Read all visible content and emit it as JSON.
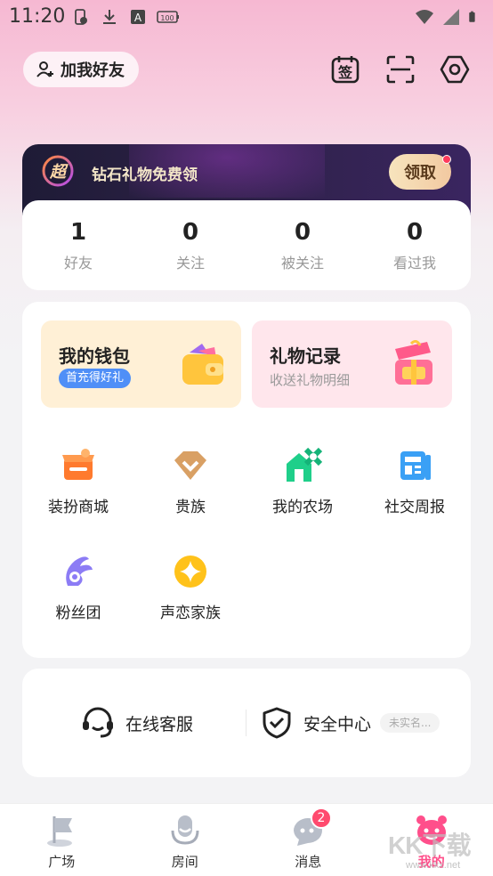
{
  "status_bar": {
    "time": "11:20",
    "left_icons": [
      "battery-saver-icon",
      "download-icon",
      "a-icon",
      "battery-100-icon"
    ],
    "battery_label": "100",
    "right_icons": [
      "wifi-icon",
      "signal-icon",
      "battery-icon"
    ]
  },
  "header": {
    "add_friend_label": "加我好友",
    "sign_in_label": "签",
    "icons": [
      "calendar-sign-icon",
      "scan-icon",
      "settings-icon"
    ]
  },
  "vip_banner": {
    "badge_text": "超",
    "text": "钻石礼物免费领",
    "claim_label": "领取"
  },
  "stats": [
    {
      "value": "1",
      "label": "好友"
    },
    {
      "value": "0",
      "label": "关注"
    },
    {
      "value": "0",
      "label": "被关注"
    },
    {
      "value": "0",
      "label": "看过我"
    }
  ],
  "wallet": {
    "title": "我的钱包",
    "tag": "首充得好礼"
  },
  "gift_record": {
    "title": "礼物记录",
    "subtitle": "收送礼物明细"
  },
  "services": [
    {
      "label": "装扮商城",
      "icon": "shop-icon"
    },
    {
      "label": "贵族",
      "icon": "diamond-icon"
    },
    {
      "label": "我的农场",
      "icon": "farm-icon"
    },
    {
      "label": "社交周报",
      "icon": "report-icon"
    },
    {
      "label": "粉丝团",
      "icon": "fan-club-icon"
    },
    {
      "label": "声恋家族",
      "icon": "star-icon"
    }
  ],
  "support": {
    "service_label": "在线客服",
    "security_label": "安全中心",
    "verify_tag": "未实名..."
  },
  "tabs": [
    {
      "label": "广场",
      "icon": "flag-icon",
      "active": false
    },
    {
      "label": "房间",
      "icon": "mic-room-icon",
      "active": false
    },
    {
      "label": "消息",
      "icon": "message-icon",
      "active": false,
      "badge": "2"
    },
    {
      "label": "我的",
      "icon": "profile-face-icon",
      "active": true
    }
  ],
  "watermark": {
    "main": "KK下载",
    "sub": "www.kkx.net"
  },
  "colors": {
    "accent": "#ff4f8b",
    "wallet_bg": "#fff0d6",
    "gift_bg": "#ffe6ec",
    "banner_bg": "#1e1b36"
  }
}
